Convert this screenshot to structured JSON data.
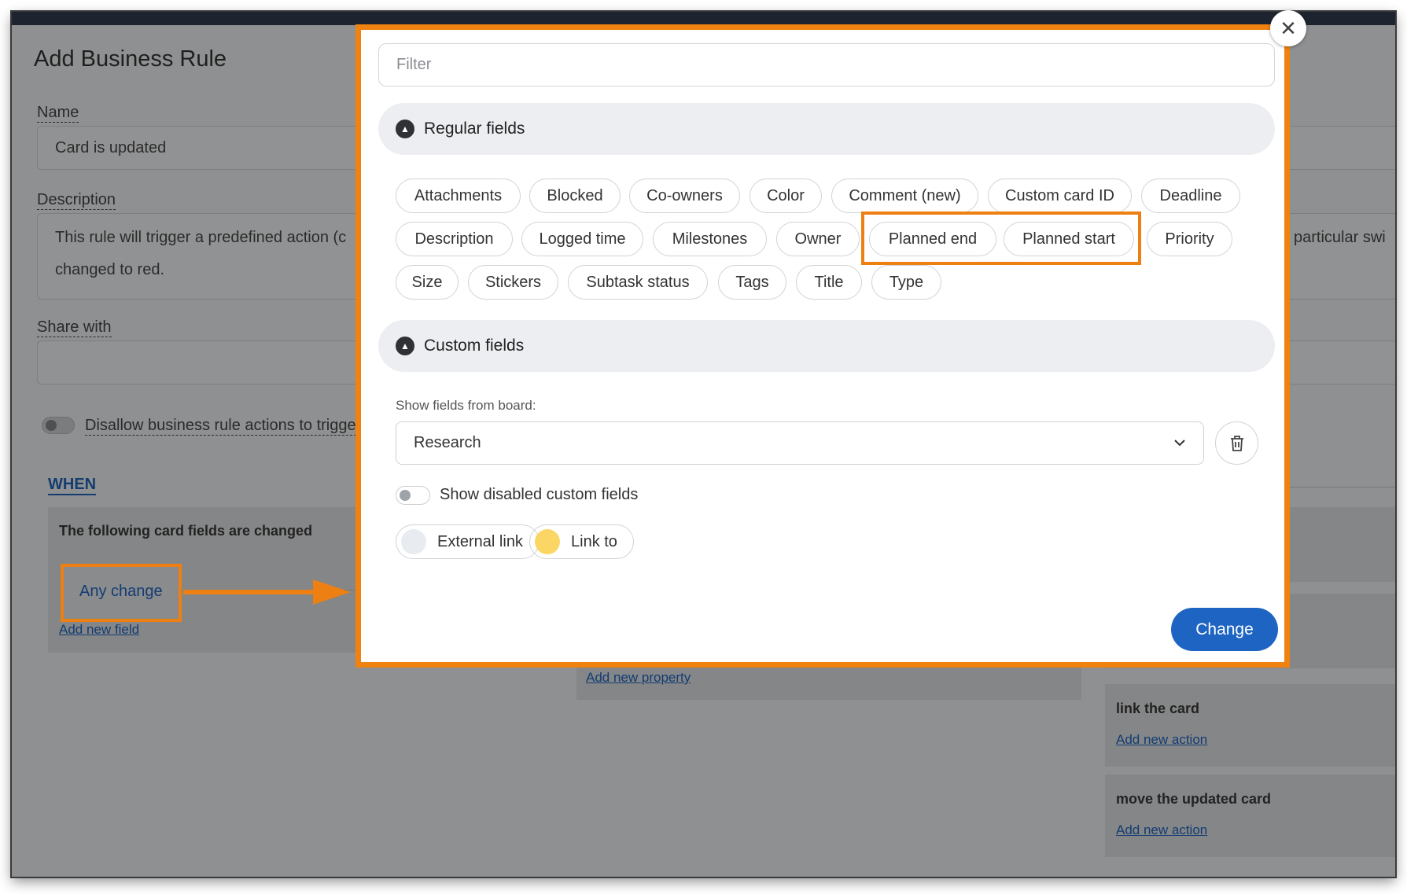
{
  "background": {
    "title": "Add Business Rule",
    "name_label": "Name",
    "name_value": "Card is updated",
    "description_label": "Description",
    "description_line1": "This rule will trigger a predefined action (c",
    "description_line2": "changed to red.",
    "description_right": "particular swi",
    "share_label": "Share with",
    "disallow_label": "Disallow business rule actions to trigge",
    "when_label": "WHEN",
    "changed_panel_title": "The following card fields are changed",
    "any_change": "Any change",
    "add_new_field": "Add new field",
    "add_new_property": "Add new property",
    "link_card_title": "link the card",
    "move_card_title": "move the updated card",
    "add_new_action": "Add new action"
  },
  "modal": {
    "filter_placeholder": "Filter",
    "regular_fields_title": "Regular fields",
    "regular_fields": [
      "Attachments",
      "Blocked",
      "Co-owners",
      "Color",
      "Comment (new)",
      "Custom card ID",
      "Deadline",
      "Description",
      "Logged time",
      "Milestones",
      "Owner",
      "Planned end",
      "Planned start",
      "Priority",
      "Size",
      "Stickers",
      "Subtask status",
      "Tags",
      "Title",
      "Type"
    ],
    "custom_fields_title": "Custom fields",
    "show_fields_label": "Show fields from board:",
    "board_select_value": "Research",
    "show_disabled_label": "Show disabled custom fields",
    "custom_chips": [
      {
        "label": "External link",
        "color": "#e8ebef"
      },
      {
        "label": "Link to",
        "color": "#fcd664"
      }
    ],
    "change_button": "Change",
    "close_symbol": "✕"
  },
  "colors": {
    "highlight": "#ee7f13",
    "primary": "#1e64c2"
  }
}
